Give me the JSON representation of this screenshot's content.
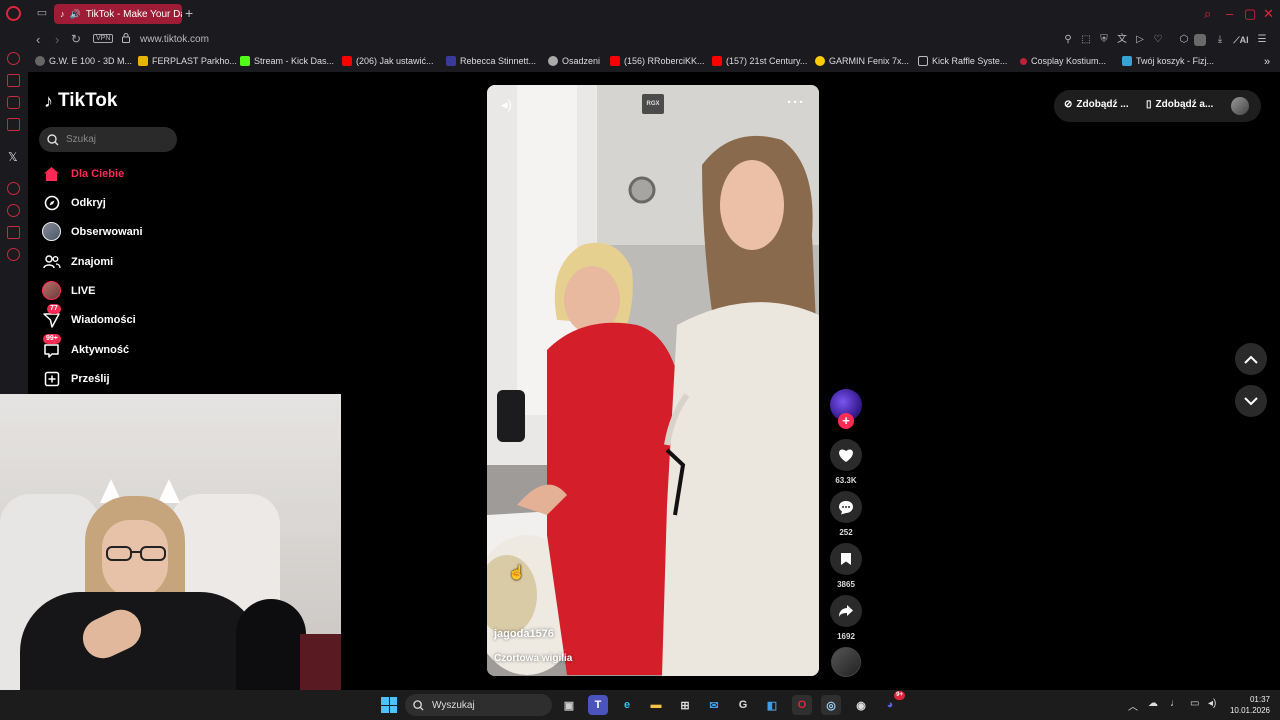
{
  "browser": {
    "tab_title": "TikTok - Make Your Da",
    "url": "www.tiktok.com",
    "vpn_label": "VPN",
    "accent": "#e0253b",
    "ai_label": "AI",
    "bookmarks": [
      {
        "label": "G.W. E 100 - 3D M...",
        "icon": "globe-icon",
        "color": "#666"
      },
      {
        "label": "FERPLAST Parkho...",
        "icon": "arrow-icon",
        "color": "#e8b400"
      },
      {
        "label": "Stream - Kick Das...",
        "icon": "kick-icon",
        "color": "#53fc18"
      },
      {
        "label": "(206) Jak ustawić...",
        "icon": "youtube-icon",
        "color": "#ff0000"
      },
      {
        "label": "Rebecca Stinnett...",
        "icon": "page-icon",
        "color": "#3a3a9a"
      },
      {
        "label": "Osadzeni",
        "icon": "circle-icon",
        "color": "#aaa"
      },
      {
        "label": "(156) RRoberciKK...",
        "icon": "youtube-icon",
        "color": "#ff0000"
      },
      {
        "label": "(157) 21st Century...",
        "icon": "youtube-icon",
        "color": "#ff0000"
      },
      {
        "label": "GARMIN Fenix 7x...",
        "icon": "garmin-icon",
        "color": "#ffcc00"
      },
      {
        "label": "Kick Raffle Syste...",
        "icon": "doc-icon",
        "color": "#bbb"
      },
      {
        "label": "Cosplay Kostium...",
        "icon": "dot-icon",
        "color": "#c0203a"
      },
      {
        "label": "Twój koszyk - Fizj...",
        "icon": "cart-icon",
        "color": "#3aa0d8"
      }
    ]
  },
  "tiktok": {
    "logo_text": "TikTok",
    "search_placeholder": "Szukaj",
    "accent": "#fe2c55",
    "nav": [
      {
        "label": "Dla Ciebie",
        "icon": "home-icon",
        "active": true
      },
      {
        "label": "Odkryj",
        "icon": "compass-icon"
      },
      {
        "label": "Obserwowani",
        "icon": "following-avatar-icon"
      },
      {
        "label": "Znajomi",
        "icon": "friends-icon"
      },
      {
        "label": "LIVE",
        "icon": "live-avatar-icon"
      },
      {
        "label": "Wiadomości",
        "icon": "messages-icon",
        "badge": "77"
      },
      {
        "label": "Aktywność",
        "icon": "activity-icon",
        "badge": "99+"
      },
      {
        "label": "Prześlij",
        "icon": "upload-icon"
      }
    ],
    "header_buttons": [
      {
        "label": "Zdobądź ...",
        "icon": "coin-icon"
      },
      {
        "label": "Zdobądź a...",
        "icon": "phone-icon"
      }
    ],
    "video": {
      "badge": "RGX",
      "author": "jagoda1576",
      "caption": "Czortowa wigilia"
    },
    "actions": {
      "likes": "63.3K",
      "comments": "252",
      "saves": "3865",
      "shares": "1692"
    }
  },
  "taskbar": {
    "search_label": "Wyszukaj",
    "discord_badge": "9+",
    "time": "01:37",
    "date": "10.01.2026"
  }
}
